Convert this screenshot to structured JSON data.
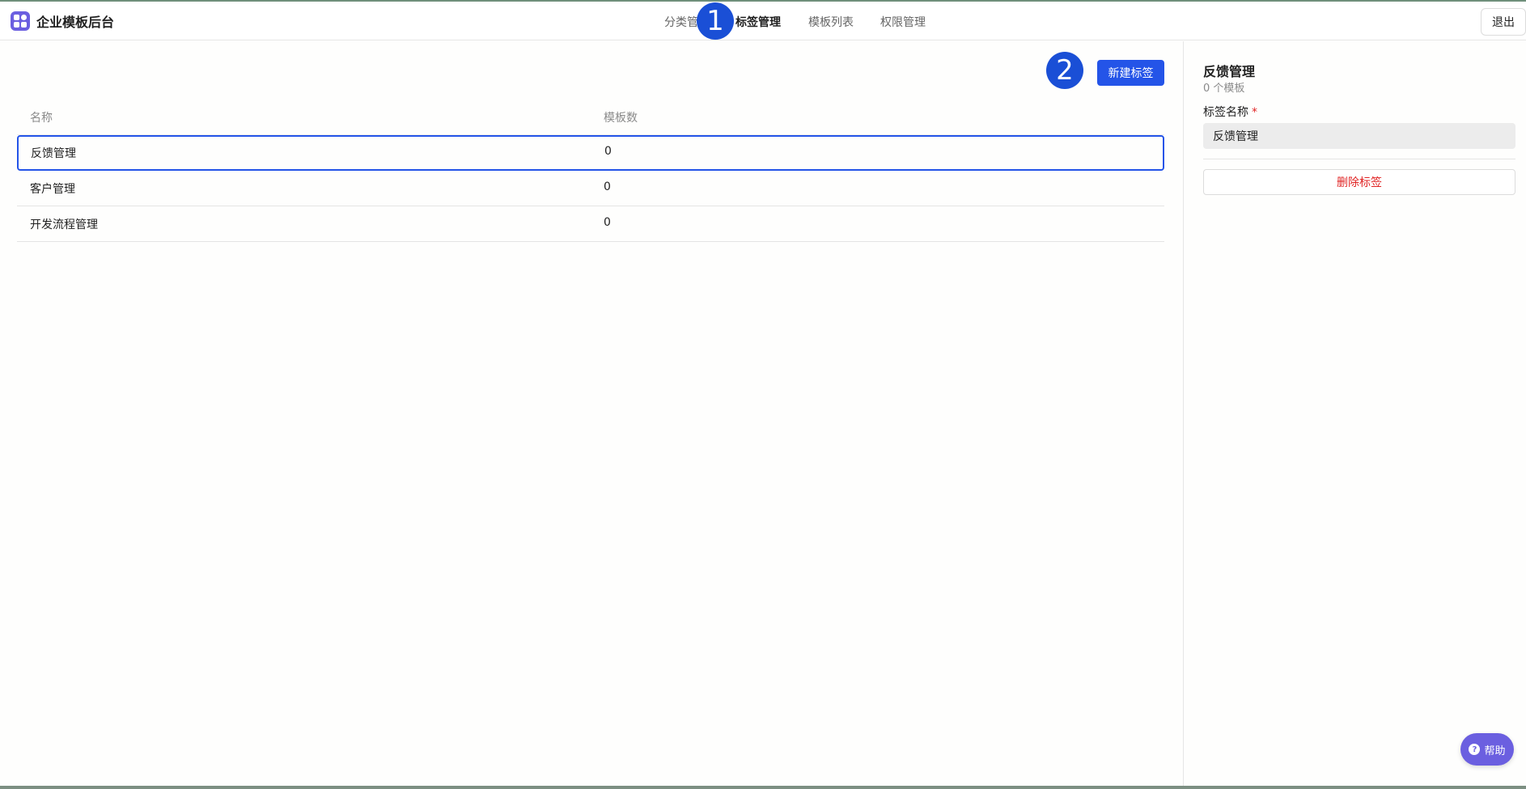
{
  "app": {
    "title": "企业模板后台"
  },
  "nav": {
    "items": [
      {
        "label": "分类管",
        "active": false
      },
      {
        "label": "标签管理",
        "active": true
      },
      {
        "label": "模板列表",
        "active": false
      },
      {
        "label": "权限管理",
        "active": false
      }
    ],
    "logout_label": "退出"
  },
  "markers": {
    "first": "1",
    "second": "2"
  },
  "toolbar": {
    "new_tag_label": "新建标签"
  },
  "table": {
    "columns": [
      "名称",
      "模板数"
    ],
    "rows": [
      {
        "name": "反馈管理",
        "count": "0",
        "selected": true
      },
      {
        "name": "客户管理",
        "count": "0",
        "selected": false
      },
      {
        "name": "开发流程管理",
        "count": "0",
        "selected": false
      }
    ]
  },
  "detail": {
    "title": "反馈管理",
    "subtitle": "0 个模板",
    "field_label": "标签名称",
    "required_mark": "*",
    "field_value": "反馈管理",
    "delete_label": "删除标签"
  },
  "help": {
    "label": "帮助",
    "icon": "question-icon"
  },
  "colors": {
    "accent": "#2454e8",
    "brand": "#6b5fe0",
    "danger": "#e02424"
  }
}
